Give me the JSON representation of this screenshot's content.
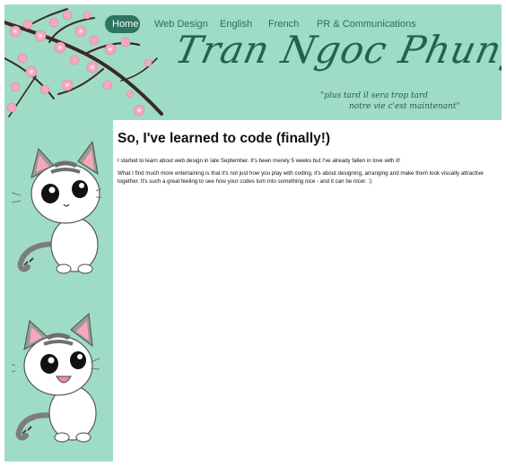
{
  "nav": {
    "items": [
      {
        "label": "Home",
        "active": true
      },
      {
        "label": "Web Design",
        "active": false
      },
      {
        "label": "English",
        "active": false
      },
      {
        "label": "French",
        "active": false
      },
      {
        "label": "PR & Communications",
        "active": false
      }
    ]
  },
  "header": {
    "site_title": "Tran Ngoc Phung",
    "tagline_line1": "\"plus tard il sera trop tard",
    "tagline_line2": "notre vie c'est maintenant\""
  },
  "post": {
    "title": "So, I've learned to code (finally!)",
    "paragraph1": "I started to learn about web design in late September. It's been merely 5 weeks but I've already fallen in love with it!",
    "paragraph2": "What I find much more entertaining is that it's not just how you play with coding, it's about designing, arranging and make them look visually attractive together. It's such a great feeling to see how your codes turn into something nice - and it can be nicer. :)"
  },
  "colors": {
    "mint": "#9fdcc6",
    "nav_active": "#2f7562",
    "title_green": "#1f6451",
    "blossom_pink": "#f3a9bf"
  },
  "images": {
    "header_decoration": "cherry-blossom-branch",
    "sidebar_top": "cat-sitting",
    "sidebar_bottom": "cat-surprised"
  }
}
